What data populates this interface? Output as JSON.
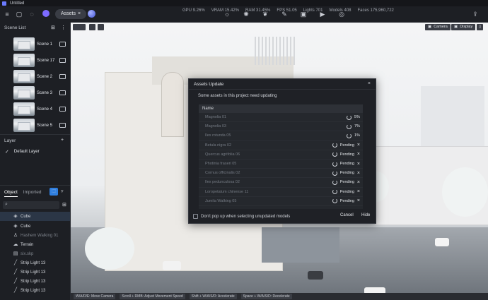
{
  "app": {
    "title": "Untitled"
  },
  "topbar": {
    "assets_label": "Assets",
    "stats": [
      "GPU 9.26%",
      "VRAM 15.42%",
      "RAM 31.45%",
      "FPS 51.05",
      "Lights 701",
      "Models 408",
      "Faces 175,960,722"
    ]
  },
  "scene_list": {
    "title": "Scene List",
    "scenes": [
      "Scene 1",
      "Scene 17",
      "Scene 2",
      "Scene 3",
      "Scene 4",
      "Scene 5"
    ]
  },
  "layer": {
    "title": "Layer",
    "items": [
      "Default Layer"
    ]
  },
  "object_panel": {
    "tabs": [
      "Object",
      "Imported"
    ],
    "items": [
      {
        "label": "Cube",
        "icon": "cube-icon"
      },
      {
        "label": "Cube",
        "icon": "cube-icon"
      },
      {
        "label": "Hashem Walking 01",
        "icon": "person-icon"
      },
      {
        "label": "Terrain",
        "icon": "cloud-icon"
      },
      {
        "label": "six.skp",
        "icon": "file-icon"
      },
      {
        "label": "Strip Light 13",
        "icon": "light-strip-icon"
      },
      {
        "label": "Strip Light 13",
        "icon": "light-strip-icon"
      },
      {
        "label": "Strip Light 13",
        "icon": "light-strip-icon"
      },
      {
        "label": "Strip Light 13",
        "icon": "light-strip-icon"
      }
    ]
  },
  "viewport": {
    "camera_label": "Camera",
    "display_label": "Display"
  },
  "statusbar": [
    "W/A/D/E: Move Camera",
    "Scroll + RMB: Adjust Movement Speed",
    "Shift + W/A/S/D: Accelerate",
    "Space + W/A/S/D: Decelerate"
  ],
  "modal": {
    "title": "Assets Update",
    "subtitle": "Some assets in this project need updating",
    "column": "Name",
    "rows": [
      {
        "name": "Magnolia 01",
        "status": "5%",
        "pending": false
      },
      {
        "name": "Magnolia 03",
        "status": "7%",
        "pending": false
      },
      {
        "name": "Ilex rotunda 05",
        "status": "1%",
        "pending": false
      },
      {
        "name": "Betula nigra 02",
        "status": "Pending",
        "pending": true
      },
      {
        "name": "Quercus agrifolia 06",
        "status": "Pending",
        "pending": true
      },
      {
        "name": "Photinia fraseri 05",
        "status": "Pending",
        "pending": true
      },
      {
        "name": "Cornus officinalis 02",
        "status": "Pending",
        "pending": true
      },
      {
        "name": "Ilex pedunculosa 02",
        "status": "Pending",
        "pending": true
      },
      {
        "name": "Loropetalum chinense 11",
        "status": "Pending",
        "pending": true
      },
      {
        "name": "Jumila Walking 05",
        "status": "Pending",
        "pending": true
      }
    ],
    "checkbox_label": "Don't pop up when selecting unupdated models",
    "cancel_label": "Cancel",
    "hide_label": "Hide"
  }
}
